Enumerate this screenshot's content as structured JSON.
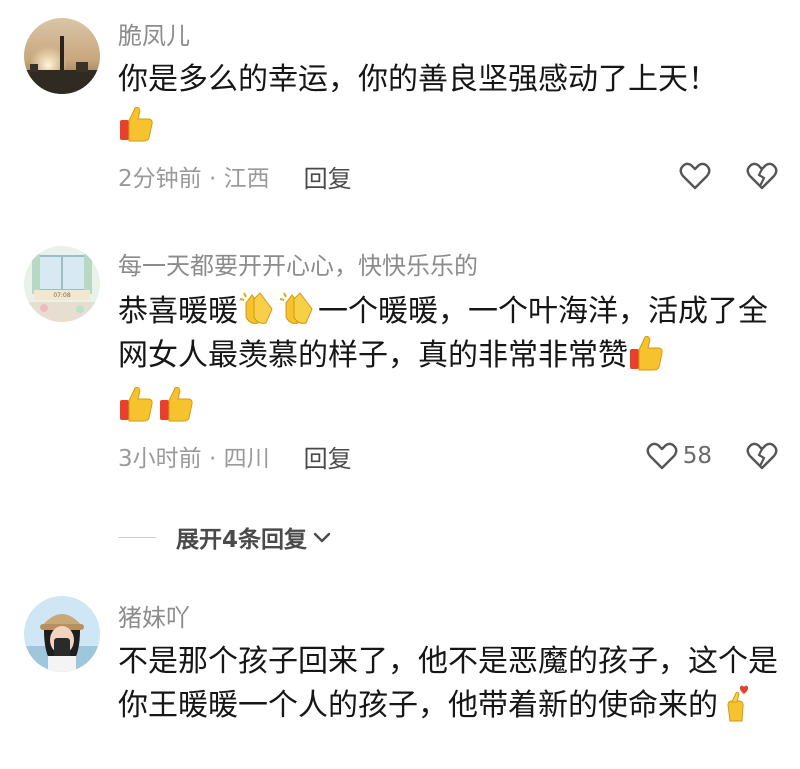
{
  "comments": [
    {
      "username": "脆凤儿",
      "text": "你是多么的幸运，你的善良坚强感动了上天！",
      "time_location": "2分钟前 · 江西",
      "reply_label": "回复",
      "like_count": "",
      "avatar": "sunset-city-photo",
      "emojis": [
        "thumbs-up"
      ]
    },
    {
      "username": "每一天都要开开心心，快快乐乐的",
      "text_part1": "恭喜暖暖",
      "text_part2": "一个暖暖，一个叶海洋，活成了全网女人最羡慕的样子，真的非常非常赞",
      "time_location": "3小时前 · 四川",
      "reply_label": "回复",
      "like_count": "58",
      "avatar": "illustrated-window-scene",
      "emojis": [
        "clapping-hands",
        "clapping-hands",
        "thumbs-up",
        "thumbs-up",
        "thumbs-up"
      ]
    },
    {
      "username": "猪妹吖",
      "text": "不是那个孩子回来了，他不是恶魔的孩子，这个是你王暖暖一个人的孩子，他带着新的使命来的",
      "avatar": "selfie-girl-cap",
      "emojis": [
        "finger-heart"
      ]
    }
  ],
  "expand_replies": {
    "label": "展开4条回复"
  },
  "icons": {
    "like": "heart-outline-icon",
    "dislike": "broken-heart-icon",
    "chevron": "chevron-down-icon"
  },
  "colors": {
    "text": "#161616",
    "secondary": "#8c8c8c",
    "emoji_yellow": "#f6c22e",
    "emoji_red": "#e8402b"
  }
}
